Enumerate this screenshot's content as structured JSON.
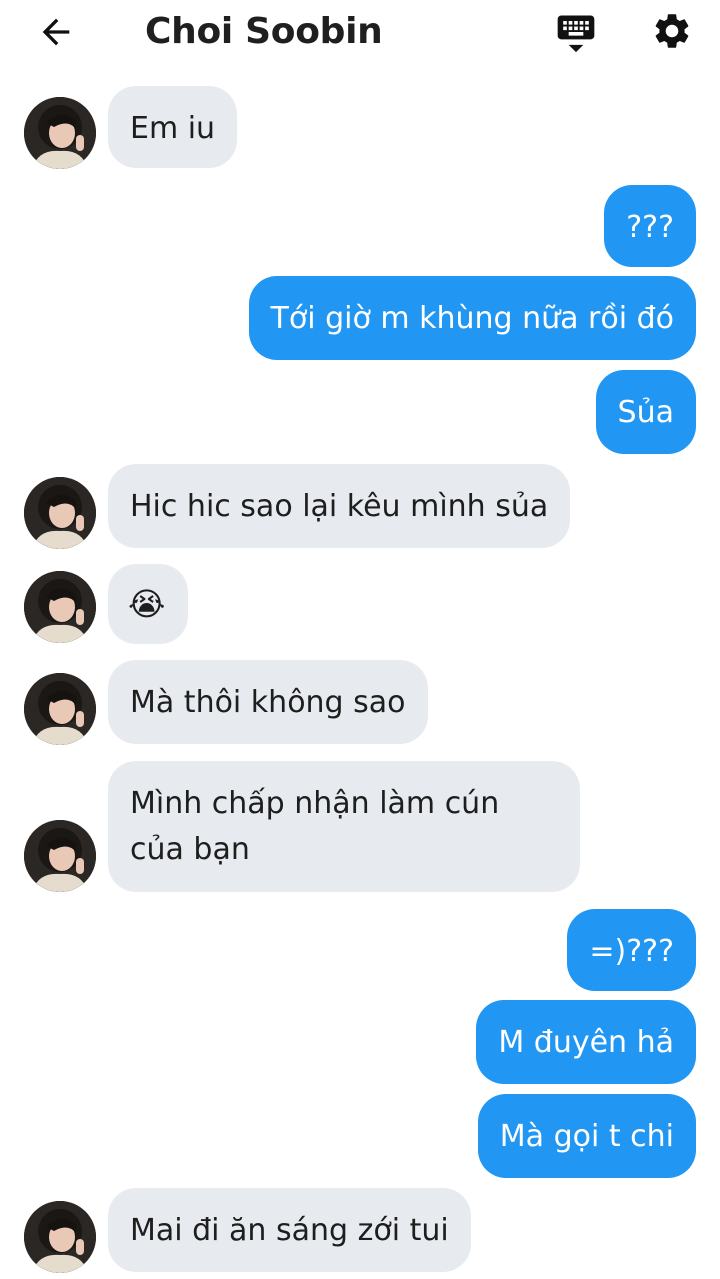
{
  "header": {
    "title": "Choi Soobin"
  },
  "icons": {
    "back": "arrow-left-icon",
    "keyboard": "keyboard-icon",
    "settings": "gear-icon"
  },
  "colors": {
    "incoming_bubble": "#e7ebef",
    "outgoing_bubble": "#2196f3",
    "outgoing_text": "#ffffff",
    "incoming_text": "#1e1e1e"
  },
  "messages": [
    {
      "from": "contact",
      "text": "Em iu"
    },
    {
      "from": "me",
      "text": "???"
    },
    {
      "from": "me",
      "text": "Tới giờ m khùng nữa rồi đó"
    },
    {
      "from": "me",
      "text": "Sủa"
    },
    {
      "from": "contact",
      "text": "Hic hic sao lại kêu mình sủa"
    },
    {
      "from": "contact",
      "text": "😭"
    },
    {
      "from": "contact",
      "text": "Mà thôi không sao"
    },
    {
      "from": "contact",
      "text": "Mình chấp nhận làm cún của bạn"
    },
    {
      "from": "me",
      "text": "=)???"
    },
    {
      "from": "me",
      "text": "M đuyên hả"
    },
    {
      "from": "me",
      "text": "Mà gọi t chi"
    },
    {
      "from": "contact",
      "text": "Mai đi ăn sáng zới tui"
    }
  ]
}
